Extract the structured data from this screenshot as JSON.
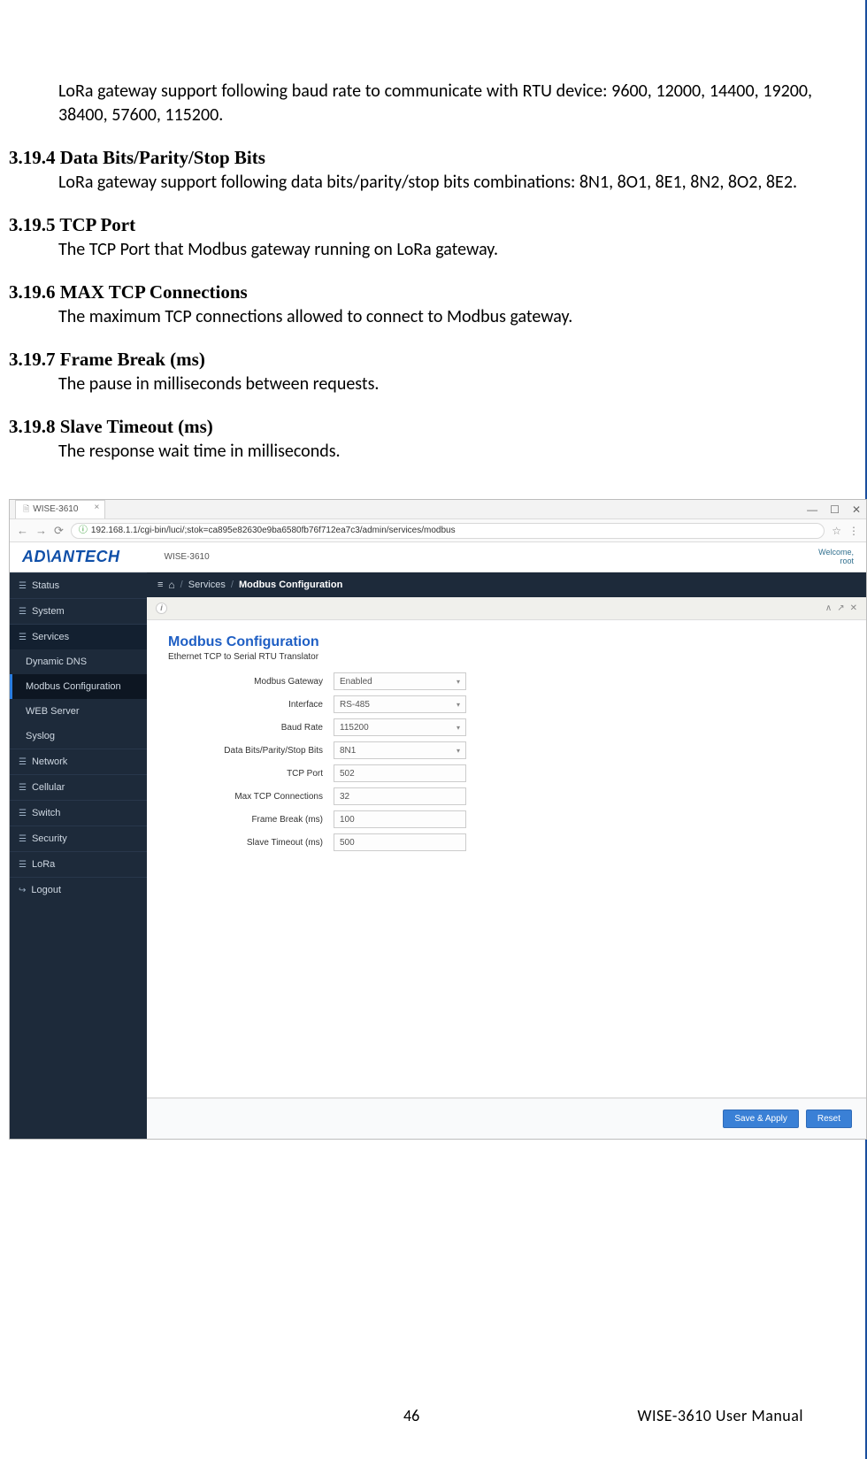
{
  "doc": {
    "intro": "LoRa gateway support following baud rate to communicate with RTU device: 9600, 12000, 14400, 19200, 38400, 57600, 115200.",
    "h1": "3.19.4 Data Bits/Parity/Stop Bits",
    "p1": "LoRa gateway support following data bits/parity/stop bits combinations: 8N1, 8O1, 8E1, 8N2, 8O2, 8E2.",
    "h2": "3.19.5 TCP Port",
    "p2": "The TCP Port that Modbus gateway running on LoRa gateway.",
    "h3": "3.19.6 MAX TCP Connections",
    "p3": "The maximum TCP connections allowed to connect to Modbus gateway.",
    "h4": "3.19.7 Frame Break (ms)",
    "p4": "The pause in milliseconds between requests.",
    "h5": "3.19.8 Slave Timeout (ms)",
    "p5": "The response wait time in milliseconds."
  },
  "browser": {
    "tab_title": "WISE-3610",
    "url": "192.168.1.1/cgi-bin/luci/;stok=ca895e82630e9ba6580fb76f712ea7c3/admin/services/modbus",
    "win_min": "—",
    "win_max": "☐",
    "win_close": "✕"
  },
  "app": {
    "brand": "AD\\ANTECH",
    "model": "WISE-3610",
    "welcome1": "Welcome,",
    "welcome2": "root"
  },
  "breadcrumb": {
    "bars": "≡",
    "services": "Services",
    "current": "Modbus Configuration"
  },
  "panelhead": {
    "c1": "∧",
    "c2": "↗",
    "c3": "✕"
  },
  "sidebar": {
    "status": "Status",
    "system": "System",
    "services": "Services",
    "ddns": "Dynamic DNS",
    "modbus": "Modbus Configuration",
    "webserver": "WEB Server",
    "syslog": "Syslog",
    "network": "Network",
    "cellular": "Cellular",
    "switch": "Switch",
    "security": "Security",
    "lora": "LoRa",
    "logout": "Logout"
  },
  "panel": {
    "title": "Modbus Configuration",
    "sub": "Ethernet TCP to Serial RTU Translator"
  },
  "form": {
    "l_gateway": "Modbus Gateway",
    "v_gateway": "Enabled",
    "l_interface": "Interface",
    "v_interface": "RS-485",
    "l_baud": "Baud Rate",
    "v_baud": "115200",
    "l_bits": "Data Bits/Parity/Stop Bits",
    "v_bits": "8N1",
    "l_tcp": "TCP Port",
    "v_tcp": "502",
    "l_max": "Max TCP Connections",
    "v_max": "32",
    "l_frame": "Frame Break (ms)",
    "v_frame": "100",
    "l_slave": "Slave Timeout (ms)",
    "v_slave": "500"
  },
  "buttons": {
    "save": "Save & Apply",
    "reset": "Reset"
  },
  "footer": {
    "page": "46",
    "manual": "WISE-3610  User  Manual"
  }
}
